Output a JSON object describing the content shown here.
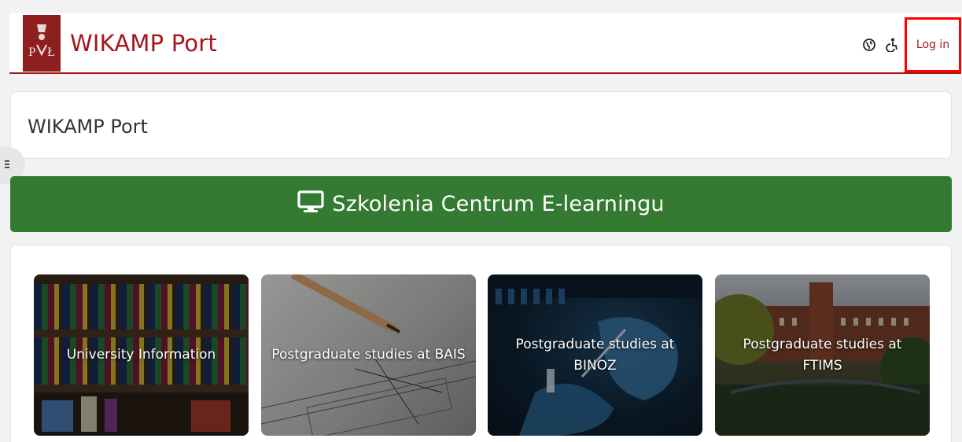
{
  "site": {
    "name": "WIKAMP Port",
    "logo_icon": "university-crest-logo",
    "brand_color": "#a3161c"
  },
  "navbar": {
    "language_icon": "globe-icon",
    "accessibility_icon": "accessibility-icon",
    "login_label": "Log in"
  },
  "page_header": {
    "title": "WIKAMP Port"
  },
  "drawer": {
    "toggle_icon": "menu-icon"
  },
  "banner": {
    "icon": "monitor-icon",
    "label": "Szkolenia Centrum E-learningu",
    "color": "#357a32"
  },
  "categories": [
    {
      "label": "University Information",
      "image": "bookshelf-binders"
    },
    {
      "label": "Postgraduate studies at BAIS",
      "image": "technical-drawing-pencil"
    },
    {
      "label": "Postgraduate studies at BINOZ",
      "image": "laboratory-pipette"
    },
    {
      "label": "Postgraduate studies at FTIMS",
      "image": "university-building"
    }
  ]
}
